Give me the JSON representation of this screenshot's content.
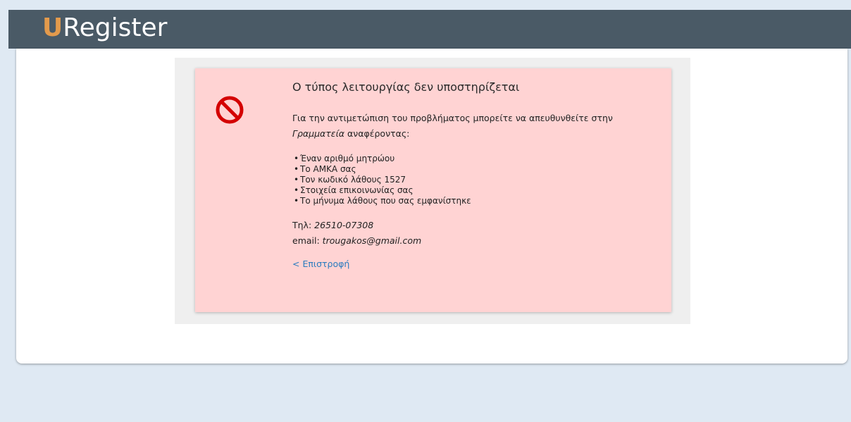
{
  "header": {
    "logo_letter": "U",
    "logo_rest": "Register",
    "bg_color": "#4a5a66",
    "accent_color": "#e39a4c"
  },
  "error": {
    "icon": "no-entry-icon",
    "title": "Ο τύπος λειτουργίας δεν υποστηρίζεται",
    "intro_text": "Για την αντιμετώπιση του προβλήματος μπορείτε να απευθυνθείτε στην",
    "intro_italic": "Γραμματεία",
    "intro_suffix": " αναφέροντας:",
    "items": [
      "Έναν αριθμό μητρώου",
      "Το ΑΜΚΑ σας",
      "Τον κωδικό λάθους 1527",
      "Στοιχεία επικοινωνίας σας",
      "Το μήνυμα λάθους που σας εμφανίστηκε"
    ],
    "phone_label": "Τηλ: ",
    "phone_value": "26510-07308",
    "email_label": "email: ",
    "email_value": "trougakos@gmail.com",
    "back_label": "< Επιστροφή",
    "box_color": "#ffd3d3"
  }
}
